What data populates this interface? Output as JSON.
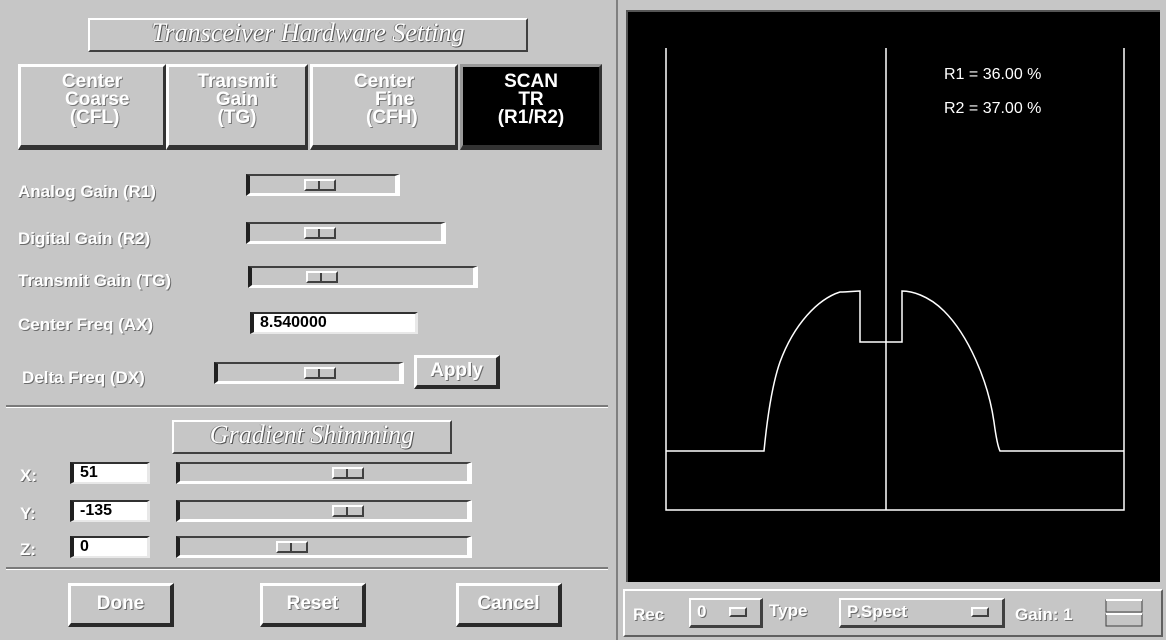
{
  "hardware": {
    "title": "Transceiver Hardware Setting",
    "tabs": [
      {
        "label": "Center\n  Coarse\n (CFL)",
        "active": false
      },
      {
        "label": "Transmit\nGain\n(TG)",
        "active": false
      },
      {
        "label": "Center\n    Fine\n   (CFH)",
        "active": false
      },
      {
        "label": "SCAN\nTR\n(R1/R2)",
        "active": true
      }
    ],
    "analog_gain_label": "Analog Gain (R1)",
    "digital_gain_label": "Digital Gain (R2)",
    "transmit_gain_label": "Transmit Gain (TG)",
    "center_freq_label": "Center Freq (AX)",
    "center_freq_value": "8.540000",
    "delta_freq_label": "Delta Freq (DX)",
    "apply_label": "Apply"
  },
  "shimming": {
    "title": "Gradient Shimming",
    "x_label": "X:",
    "x_value": "51",
    "y_label": "Y:",
    "y_value": "-135",
    "z_label": "Z:",
    "z_value": "0"
  },
  "actions": {
    "done": "Done",
    "reset": "Reset",
    "cancel": "Cancel"
  },
  "display": {
    "r1_readout": "R1 = 36.00 %",
    "r2_readout": "R2 = 37.00 %",
    "trace_color": "#ffffff",
    "background_color": "#000000"
  },
  "controls": {
    "rec_label": "Rec",
    "rec_value": "0",
    "type_label": "Type",
    "type_value": "P.Spect",
    "gain_label": "Gain: 1"
  }
}
